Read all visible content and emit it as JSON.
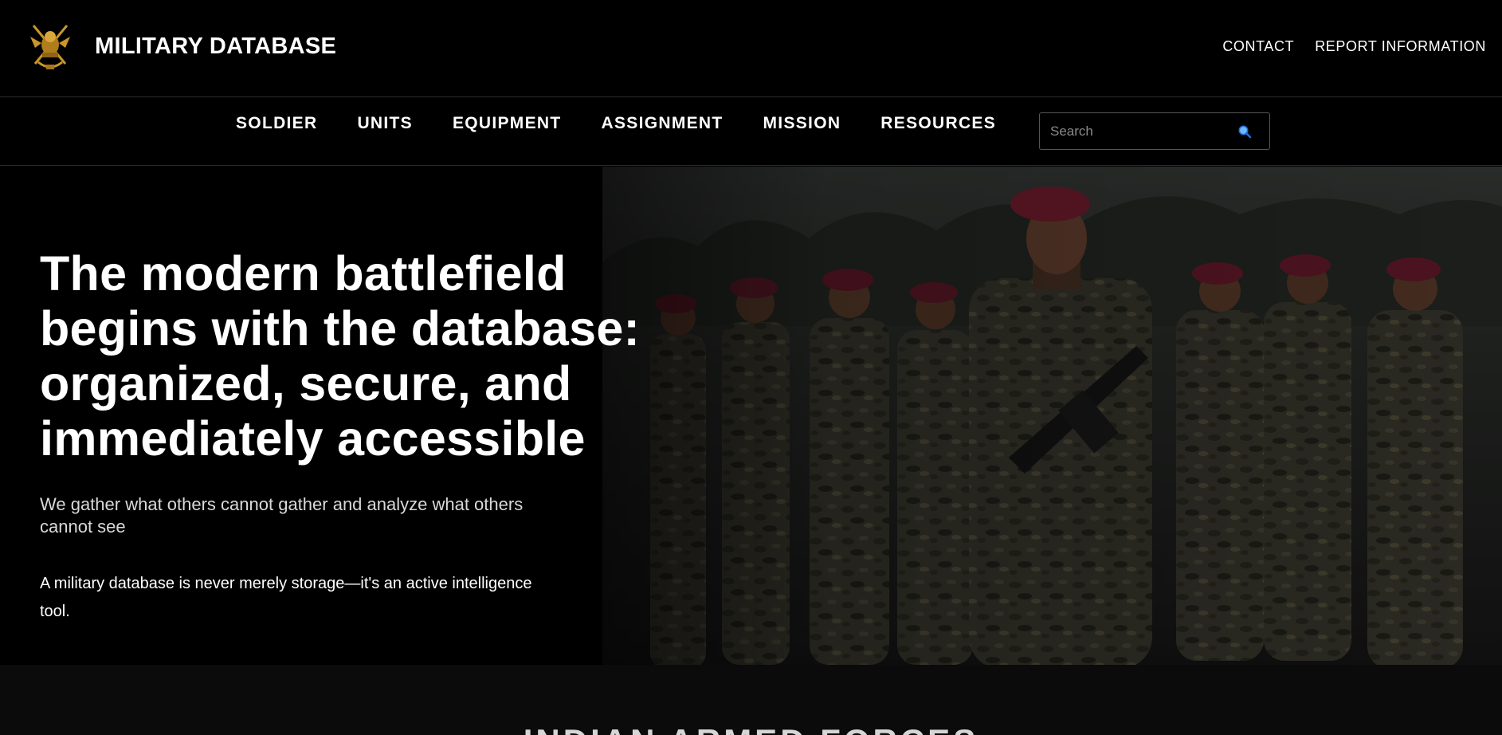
{
  "header": {
    "brand": "MILITARY DATABASE",
    "logo_icon": "military-emblem-icon",
    "links": [
      "CONTACT",
      "REPORT INFORMATION"
    ]
  },
  "nav": {
    "items": [
      "SOLDIER",
      "UNITS",
      "EQUIPMENT",
      "ASSIGNMENT",
      "MISSION",
      "RESOURCES"
    ],
    "search": {
      "placeholder": "Search",
      "value": "",
      "icon": "search-icon"
    }
  },
  "hero": {
    "heading_lines": [
      "The modern battlefield",
      "begins with the database:",
      "organized, secure, and",
      "immediately accessible"
    ],
    "subheading": "We gather what others cannot gather and analyze what others cannot see",
    "description": "A military database is never merely storage—it's an active intelligence tool."
  },
  "section": {
    "title": "INDIAN ARMED FORCES"
  },
  "colors": {
    "background": "#000000",
    "text": "#ffffff",
    "subtext": "#d9d9d9",
    "accent_gold": "#c9962a",
    "beret_maroon": "#7a1f33",
    "search_icon": "#1e90ff"
  }
}
